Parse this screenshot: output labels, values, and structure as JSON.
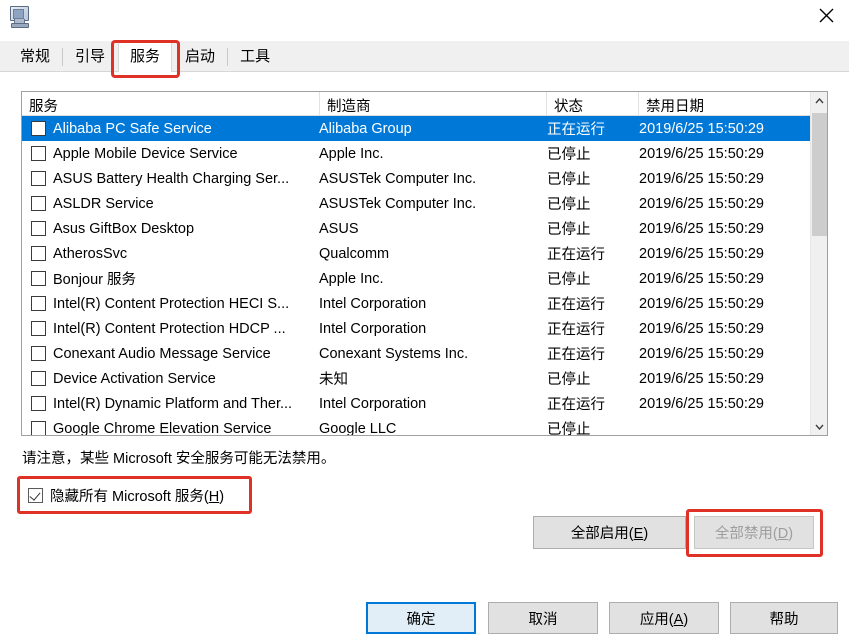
{
  "window": {
    "icon": "system-config-icon",
    "close_label": "✕"
  },
  "tabs": [
    {
      "label": "常规",
      "active": false
    },
    {
      "label": "引导",
      "active": false
    },
    {
      "label": "服务",
      "active": true
    },
    {
      "label": "启动",
      "active": false
    },
    {
      "label": "工具",
      "active": false
    }
  ],
  "table": {
    "columns": [
      "服务",
      "制造商",
      "状态",
      "禁用日期"
    ],
    "rows": [
      {
        "checked": false,
        "selected": true,
        "name": "Alibaba PC Safe Service",
        "maker": "Alibaba Group",
        "status": "正在运行",
        "date": "2019/6/25 15:50:29"
      },
      {
        "checked": false,
        "selected": false,
        "name": "Apple Mobile Device Service",
        "maker": "Apple Inc.",
        "status": "已停止",
        "date": "2019/6/25 15:50:29"
      },
      {
        "checked": false,
        "selected": false,
        "name": "ASUS Battery Health Charging Ser...",
        "maker": "ASUSTek Computer Inc.",
        "status": "已停止",
        "date": "2019/6/25 15:50:29"
      },
      {
        "checked": false,
        "selected": false,
        "name": "ASLDR Service",
        "maker": "ASUSTek Computer Inc.",
        "status": "已停止",
        "date": "2019/6/25 15:50:29"
      },
      {
        "checked": false,
        "selected": false,
        "name": "Asus GiftBox Desktop",
        "maker": "ASUS",
        "status": "已停止",
        "date": "2019/6/25 15:50:29"
      },
      {
        "checked": false,
        "selected": false,
        "name": "AtherosSvc",
        "maker": "Qualcomm",
        "status": "正在运行",
        "date": "2019/6/25 15:50:29"
      },
      {
        "checked": false,
        "selected": false,
        "name": "Bonjour 服务",
        "maker": "Apple Inc.",
        "status": "已停止",
        "date": "2019/6/25 15:50:29"
      },
      {
        "checked": false,
        "selected": false,
        "name": "Intel(R) Content Protection HECI S...",
        "maker": "Intel Corporation",
        "status": "正在运行",
        "date": "2019/6/25 15:50:29"
      },
      {
        "checked": false,
        "selected": false,
        "name": "Intel(R) Content Protection HDCP ...",
        "maker": "Intel Corporation",
        "status": "正在运行",
        "date": "2019/6/25 15:50:29"
      },
      {
        "checked": false,
        "selected": false,
        "name": "Conexant Audio Message Service",
        "maker": "Conexant Systems Inc.",
        "status": "正在运行",
        "date": "2019/6/25 15:50:29"
      },
      {
        "checked": false,
        "selected": false,
        "name": "Device Activation Service",
        "maker": "未知",
        "status": "已停止",
        "date": "2019/6/25 15:50:29"
      },
      {
        "checked": false,
        "selected": false,
        "name": "Intel(R) Dynamic Platform and Ther...",
        "maker": "Intel Corporation",
        "status": "正在运行",
        "date": "2019/6/25 15:50:29"
      },
      {
        "checked": false,
        "selected": false,
        "name": "Google Chrome Elevation Service",
        "maker": "Google LLC",
        "status": "已停止",
        "date": ""
      }
    ]
  },
  "note": "请注意，某些 Microsoft 安全服务可能无法禁用。",
  "hide_ms": {
    "label_prefix": "隐藏所有 Microsoft 服务(",
    "accel": "H",
    "label_suffix": ")",
    "checked": true
  },
  "buttons": {
    "enable_all_prefix": "全部启用(",
    "enable_all_accel": "E",
    "enable_all_suffix": ")",
    "disable_all_prefix": "全部禁用(",
    "disable_all_accel": "D",
    "disable_all_suffix": ")",
    "ok": "确定",
    "cancel": "取消",
    "apply_prefix": "应用(",
    "apply_accel": "A",
    "apply_suffix": ")",
    "help": "帮助"
  },
  "annotations": {
    "highlight_color": "#e03127",
    "accent_color": "#0078d7",
    "targets": [
      "tab-services",
      "disable-all-button",
      "hide-microsoft-services-checkbox"
    ]
  }
}
